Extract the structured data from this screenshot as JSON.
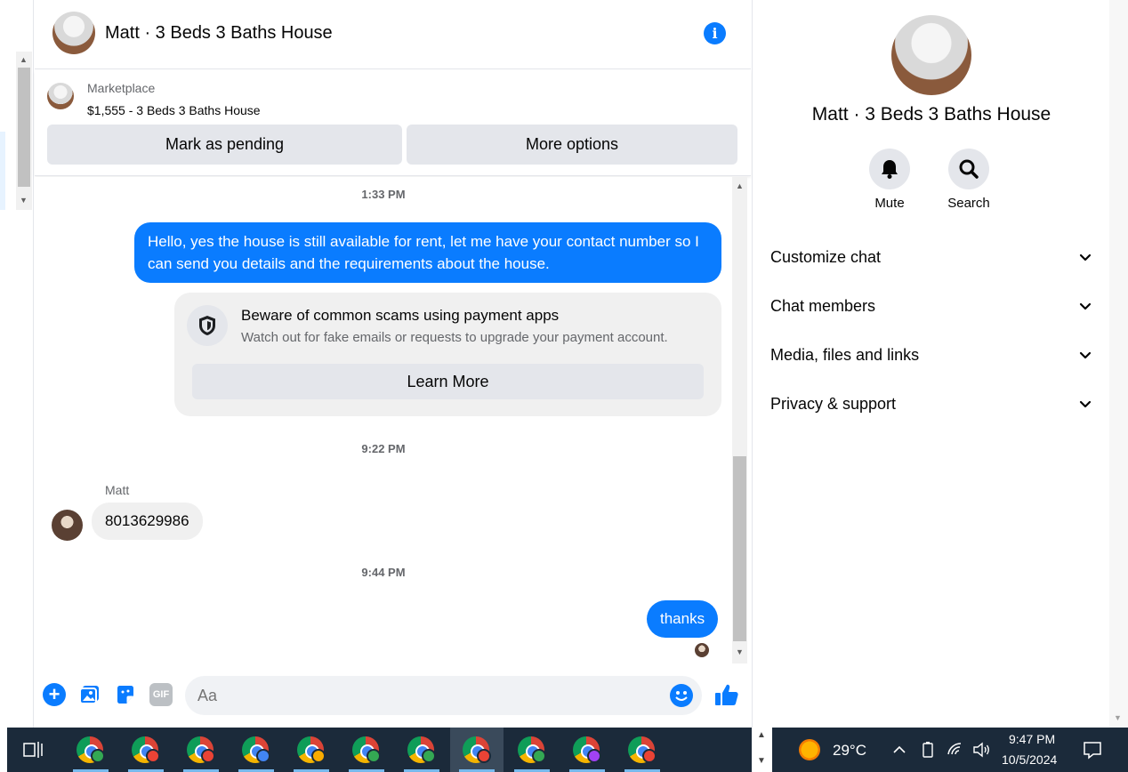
{
  "header": {
    "title": "Matt · 3 Beds 3 Baths House",
    "info_icon": "info-icon"
  },
  "marketplace": {
    "label": "Marketplace",
    "listing": "$1,555 - 3 Beds 3 Baths House",
    "mark_pending_label": "Mark as pending",
    "more_options_label": "More options"
  },
  "messages": {
    "time_1": "1:33 PM",
    "hello_text": "Hello, yes the house is still available for rent, let me have your contact number so I can send you details and the requirements about the house.",
    "scam_title": "Beware of common scams using payment apps",
    "scam_body": "Watch out for fake emails or requests to upgrade your payment account.",
    "learn_more_label": "Learn More",
    "time_2": "9:22 PM",
    "sender_name": "Matt",
    "phone_text": "8013629986",
    "time_3": "9:44 PM",
    "thanks_text": "thanks"
  },
  "composer": {
    "placeholder": "Aa",
    "gif_label": "GIF"
  },
  "right_panel": {
    "title": "Matt · 3 Beds 3 Baths House",
    "mute_label": "Mute",
    "search_label": "Search",
    "rows": [
      {
        "label": "Customize chat"
      },
      {
        "label": "Chat members"
      },
      {
        "label": "Media, files and links"
      },
      {
        "label": "Privacy & support"
      }
    ]
  },
  "taskbar": {
    "temperature": "29°C",
    "time": "9:47 PM",
    "date": "10/5/2024",
    "apps": [
      {
        "icon": "chrome-icon",
        "profile_color": "#34a853"
      },
      {
        "icon": "chrome-icon",
        "profile_color": "#ea4335"
      },
      {
        "icon": "chrome-icon",
        "profile_color": "#ea4335"
      },
      {
        "icon": "chrome-icon",
        "profile_color": "#4285f4"
      },
      {
        "icon": "chrome-icon",
        "profile_color": "#f9ab00"
      },
      {
        "icon": "chrome-icon",
        "profile_color": "#34a853"
      },
      {
        "icon": "chrome-icon",
        "profile_color": "#34a853"
      },
      {
        "icon": "chrome-icon",
        "profile_color": "#ea4335"
      },
      {
        "icon": "chrome-icon",
        "profile_color": "#34a853"
      },
      {
        "icon": "chrome-icon",
        "profile_color": "#a142f4"
      },
      {
        "icon": "chrome-icon",
        "profile_color": "#ea4335"
      }
    ]
  },
  "colors": {
    "accent": "#0a7cff",
    "bubble_in": "#f0f0f0",
    "taskbar": "#1b2a3a"
  }
}
